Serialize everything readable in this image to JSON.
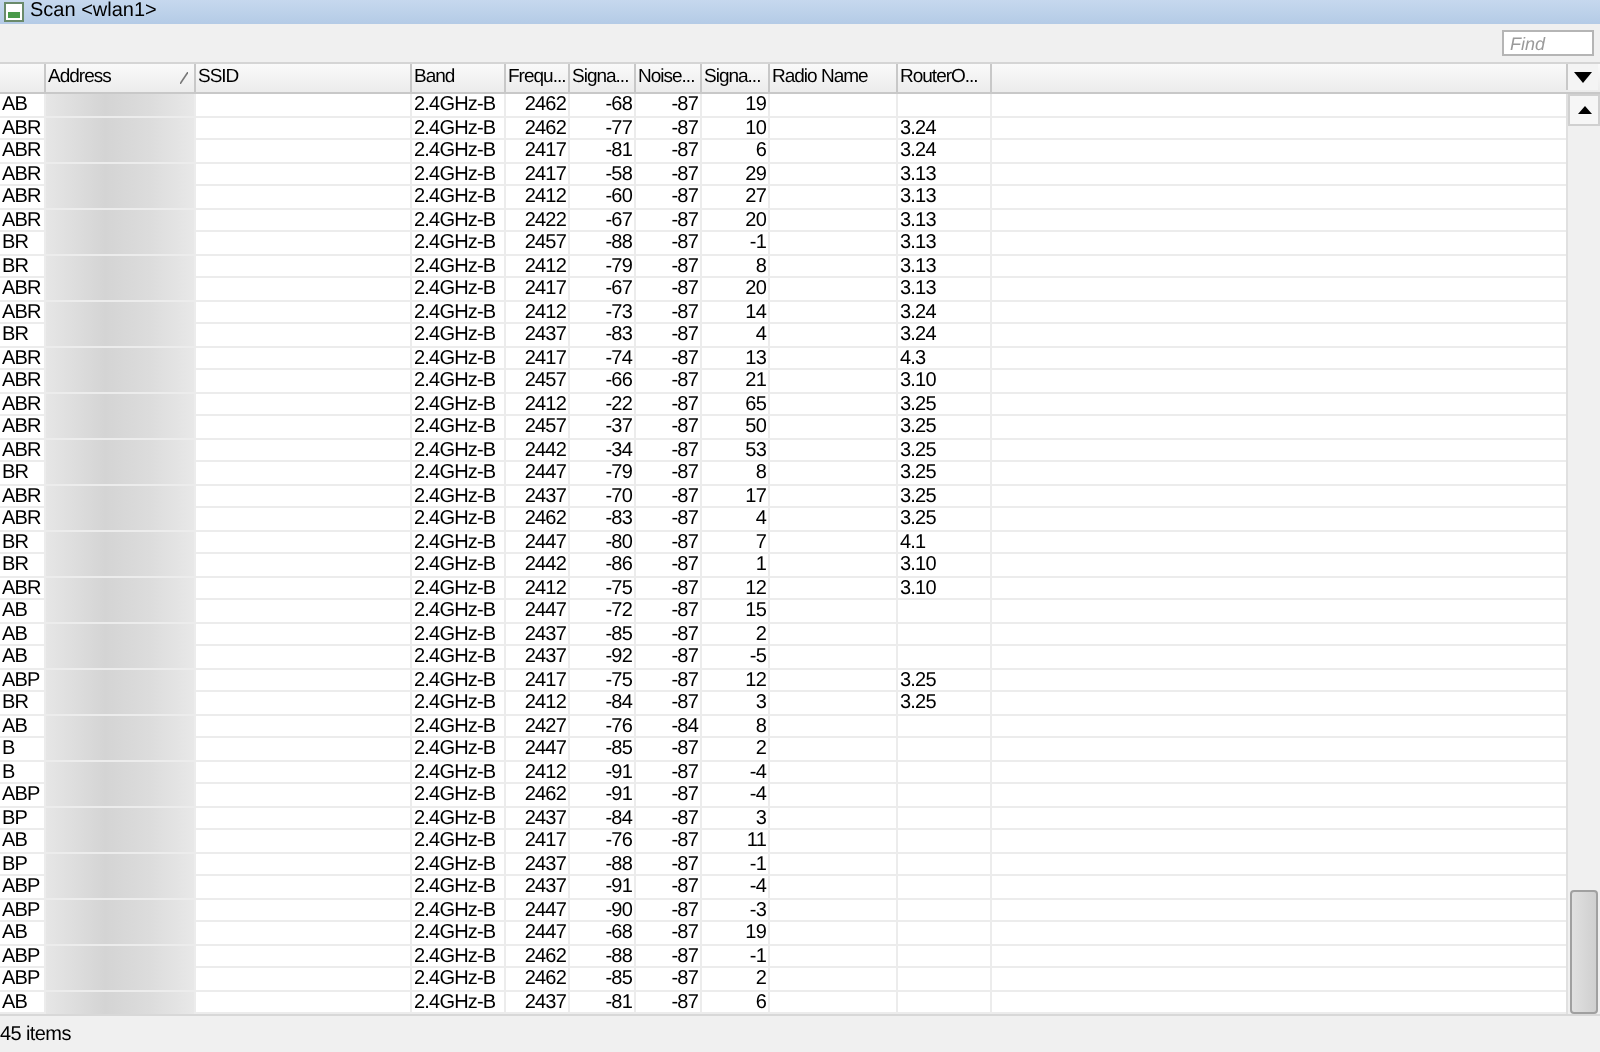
{
  "window": {
    "title": "Scan <wlan1>"
  },
  "search": {
    "placeholder": "Find"
  },
  "table": {
    "columns": [
      {},
      {
        "label": "Address",
        "sorted": true
      },
      {
        "label": "SSID"
      },
      {
        "label": "Band"
      },
      {
        "label": "Frequ..."
      },
      {
        "label": "Signa..."
      },
      {
        "label": "Noise..."
      },
      {
        "label": "Signa..."
      },
      {
        "label": "Radio Name"
      },
      {
        "label": "RouterO..."
      }
    ],
    "rows": [
      {
        "flags": "AB",
        "band": "2.4GHz-B",
        "frequency": "2462",
        "signal": "-68",
        "noise": "-87",
        "snr": "19"
      },
      {
        "flags": "ABR",
        "band": "2.4GHz-B",
        "frequency": "2462",
        "signal": "-77",
        "noise": "-87",
        "snr": "10",
        "router_os": "3.24"
      },
      {
        "flags": "ABR",
        "band": "2.4GHz-B",
        "frequency": "2417",
        "signal": "-81",
        "noise": "-87",
        "snr": "6",
        "router_os": "3.24"
      },
      {
        "flags": "ABR",
        "band": "2.4GHz-B",
        "frequency": "2417",
        "signal": "-58",
        "noise": "-87",
        "snr": "29",
        "router_os": "3.13"
      },
      {
        "flags": "ABR",
        "band": "2.4GHz-B",
        "frequency": "2412",
        "signal": "-60",
        "noise": "-87",
        "snr": "27",
        "router_os": "3.13"
      },
      {
        "flags": "ABR",
        "band": "2.4GHz-B",
        "frequency": "2422",
        "signal": "-67",
        "noise": "-87",
        "snr": "20",
        "router_os": "3.13"
      },
      {
        "flags": "BR",
        "band": "2.4GHz-B",
        "frequency": "2457",
        "signal": "-88",
        "noise": "-87",
        "snr": "-1",
        "router_os": "3.13"
      },
      {
        "flags": "BR",
        "band": "2.4GHz-B",
        "frequency": "2412",
        "signal": "-79",
        "noise": "-87",
        "snr": "8",
        "router_os": "3.13"
      },
      {
        "flags": "ABR",
        "band": "2.4GHz-B",
        "frequency": "2417",
        "signal": "-67",
        "noise": "-87",
        "snr": "20",
        "router_os": "3.13"
      },
      {
        "flags": "ABR",
        "band": "2.4GHz-B",
        "frequency": "2412",
        "signal": "-73",
        "noise": "-87",
        "snr": "14",
        "router_os": "3.24"
      },
      {
        "flags": "BR",
        "band": "2.4GHz-B",
        "frequency": "2437",
        "signal": "-83",
        "noise": "-87",
        "snr": "4",
        "router_os": "3.24"
      },
      {
        "flags": "ABR",
        "band": "2.4GHz-B",
        "frequency": "2417",
        "signal": "-74",
        "noise": "-87",
        "snr": "13",
        "router_os": "4.3"
      },
      {
        "flags": "ABR",
        "band": "2.4GHz-B",
        "frequency": "2457",
        "signal": "-66",
        "noise": "-87",
        "snr": "21",
        "router_os": "3.10"
      },
      {
        "flags": "ABR",
        "band": "2.4GHz-B",
        "frequency": "2412",
        "signal": "-22",
        "noise": "-87",
        "snr": "65",
        "router_os": "3.25"
      },
      {
        "flags": "ABR",
        "band": "2.4GHz-B",
        "frequency": "2457",
        "signal": "-37",
        "noise": "-87",
        "snr": "50",
        "router_os": "3.25"
      },
      {
        "flags": "ABR",
        "band": "2.4GHz-B",
        "frequency": "2442",
        "signal": "-34",
        "noise": "-87",
        "snr": "53",
        "router_os": "3.25"
      },
      {
        "flags": "BR",
        "band": "2.4GHz-B",
        "frequency": "2447",
        "signal": "-79",
        "noise": "-87",
        "snr": "8",
        "router_os": "3.25"
      },
      {
        "flags": "ABR",
        "band": "2.4GHz-B",
        "frequency": "2437",
        "signal": "-70",
        "noise": "-87",
        "snr": "17",
        "router_os": "3.25"
      },
      {
        "flags": "ABR",
        "band": "2.4GHz-B",
        "frequency": "2462",
        "signal": "-83",
        "noise": "-87",
        "snr": "4",
        "router_os": "3.25"
      },
      {
        "flags": "BR",
        "band": "2.4GHz-B",
        "frequency": "2447",
        "signal": "-80",
        "noise": "-87",
        "snr": "7",
        "router_os": "4.1"
      },
      {
        "flags": "BR",
        "band": "2.4GHz-B",
        "frequency": "2442",
        "signal": "-86",
        "noise": "-87",
        "snr": "1",
        "router_os": "3.10"
      },
      {
        "flags": "ABR",
        "band": "2.4GHz-B",
        "frequency": "2412",
        "signal": "-75",
        "noise": "-87",
        "snr": "12",
        "router_os": "3.10"
      },
      {
        "flags": "AB",
        "band": "2.4GHz-B",
        "frequency": "2447",
        "signal": "-72",
        "noise": "-87",
        "snr": "15"
      },
      {
        "flags": "AB",
        "band": "2.4GHz-B",
        "frequency": "2437",
        "signal": "-85",
        "noise": "-87",
        "snr": "2"
      },
      {
        "flags": "AB",
        "band": "2.4GHz-B",
        "frequency": "2437",
        "signal": "-92",
        "noise": "-87",
        "snr": "-5"
      },
      {
        "flags": "ABP",
        "band": "2.4GHz-B",
        "frequency": "2417",
        "signal": "-75",
        "noise": "-87",
        "snr": "12",
        "router_os": "3.25"
      },
      {
        "flags": "BR",
        "band": "2.4GHz-B",
        "frequency": "2412",
        "signal": "-84",
        "noise": "-87",
        "snr": "3",
        "router_os": "3.25"
      },
      {
        "flags": "AB",
        "band": "2.4GHz-B",
        "frequency": "2427",
        "signal": "-76",
        "noise": "-84",
        "snr": "8"
      },
      {
        "flags": "B",
        "band": "2.4GHz-B",
        "frequency": "2447",
        "signal": "-85",
        "noise": "-87",
        "snr": "2"
      },
      {
        "flags": "B",
        "band": "2.4GHz-B",
        "frequency": "2412",
        "signal": "-91",
        "noise": "-87",
        "snr": "-4"
      },
      {
        "flags": "ABP",
        "band": "2.4GHz-B",
        "frequency": "2462",
        "signal": "-91",
        "noise": "-87",
        "snr": "-4"
      },
      {
        "flags": "BP",
        "band": "2.4GHz-B",
        "frequency": "2437",
        "signal": "-84",
        "noise": "-87",
        "snr": "3"
      },
      {
        "flags": "AB",
        "band": "2.4GHz-B",
        "frequency": "2417",
        "signal": "-76",
        "noise": "-87",
        "snr": "11"
      },
      {
        "flags": "BP",
        "band": "2.4GHz-B",
        "frequency": "2437",
        "signal": "-88",
        "noise": "-87",
        "snr": "-1"
      },
      {
        "flags": "ABP",
        "band": "2.4GHz-B",
        "frequency": "2437",
        "signal": "-91",
        "noise": "-87",
        "snr": "-4"
      },
      {
        "flags": "ABP",
        "band": "2.4GHz-B",
        "frequency": "2447",
        "signal": "-90",
        "noise": "-87",
        "snr": "-3"
      },
      {
        "flags": "AB",
        "band": "2.4GHz-B",
        "frequency": "2447",
        "signal": "-68",
        "noise": "-87",
        "snr": "19"
      },
      {
        "flags": "ABP",
        "band": "2.4GHz-B",
        "frequency": "2462",
        "signal": "-88",
        "noise": "-87",
        "snr": "-1"
      },
      {
        "flags": "ABP",
        "band": "2.4GHz-B",
        "frequency": "2462",
        "signal": "-85",
        "noise": "-87",
        "snr": "2"
      },
      {
        "flags": "AB",
        "band": "2.4GHz-B",
        "frequency": "2437",
        "signal": "-81",
        "noise": "-87",
        "snr": "6"
      }
    ]
  },
  "status_bar": {
    "text": "45 items"
  }
}
